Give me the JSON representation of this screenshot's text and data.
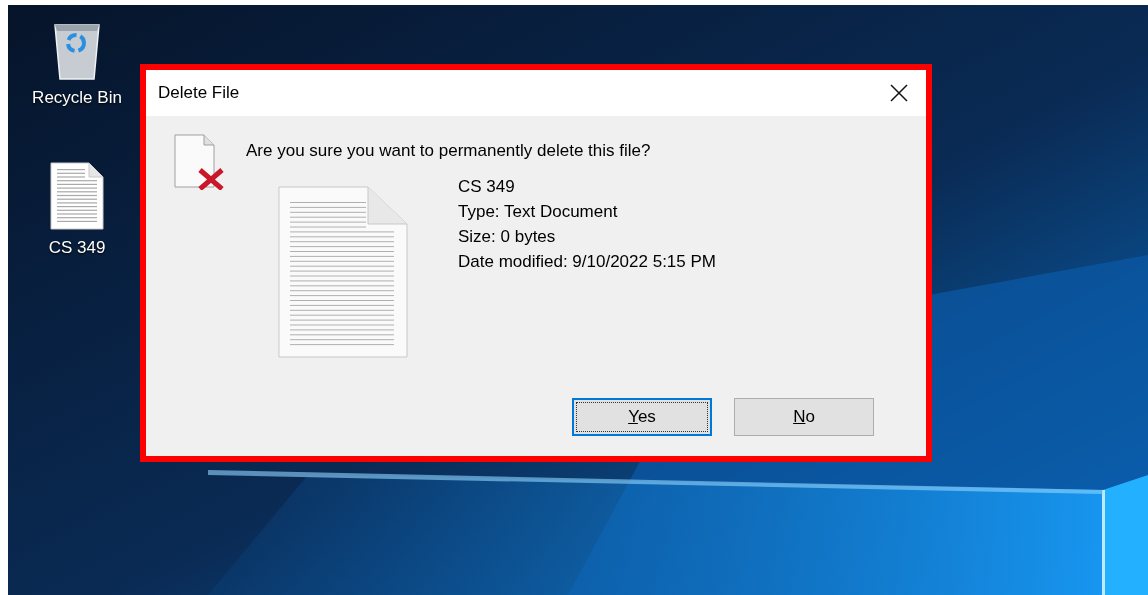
{
  "desktop": {
    "icons": [
      {
        "kind": "recycle_bin",
        "label": "Recycle Bin"
      },
      {
        "kind": "text_file",
        "label": "CS 349"
      }
    ]
  },
  "dialog": {
    "title": "Delete File",
    "highlighted": true,
    "message": "Are you sure you want to permanently delete this file?",
    "file": {
      "name": "CS 349",
      "details": [
        "Type: Text Document",
        "Size: 0 bytes",
        "Date modified: 9/10/2022 5:15 PM"
      ]
    },
    "buttons": [
      {
        "label": "Yes",
        "underline_first": true,
        "default": true
      },
      {
        "label": "No",
        "underline_first": true,
        "default": false
      }
    ]
  }
}
